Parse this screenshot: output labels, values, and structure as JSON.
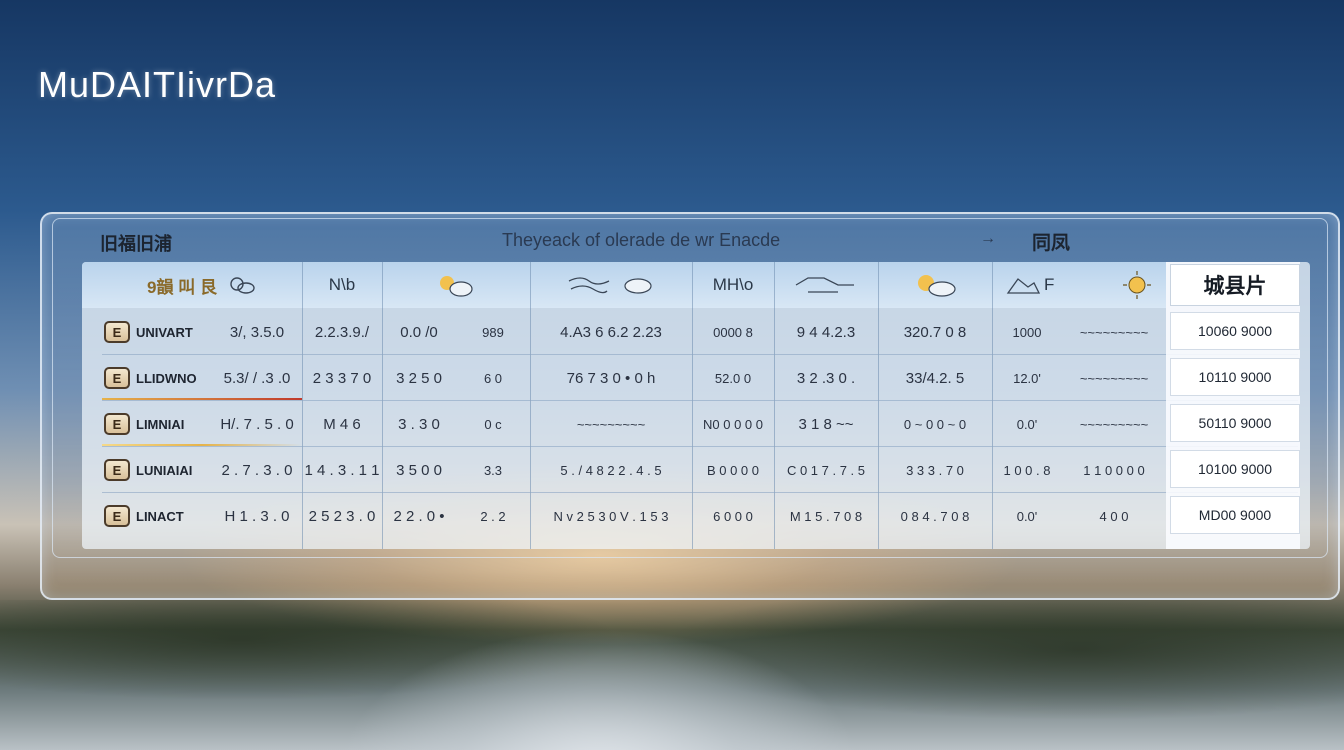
{
  "brand": "MuDAITIivrDa",
  "panel": {
    "header_left": "旧福旧浦",
    "header_mid": "Theyeack of olerade de wr Enacde",
    "header_arrow": "→",
    "header_right": "同凤"
  },
  "table": {
    "headers": [
      {
        "label": "9韻 叫 艮",
        "icon": "sun-cloud-icon"
      },
      {
        "label": "N\\b",
        "icon": "moon-icon"
      },
      {
        "label": "",
        "icon": "sun-cloud-icon"
      },
      {
        "label": "",
        "icon": "sun-cloud-icon"
      },
      {
        "label": "",
        "icon": "wind-icon"
      },
      {
        "label": "",
        "icon": "cloud-icon"
      },
      {
        "label": "MH\\o",
        "icon": ""
      },
      {
        "label": "",
        "icon": "wind-icon"
      },
      {
        "label": "",
        "icon": "sun-cloud-icon"
      },
      {
        "label": "F",
        "icon": "mountain-icon"
      },
      {
        "label": "",
        "icon": "sun-icon"
      }
    ],
    "right_header": "城县片",
    "rows": [
      {
        "month": "UNIVART",
        "badge": "E",
        "cells": [
          "3/, 3.5.0",
          "2.2.3.9./",
          "0.0 /0",
          "989",
          "4.A3 6 6.2 2.23",
          "0000 8",
          "9 4 4.2.3",
          "320.7 0 8",
          "1000",
          "~~~~~~~~~"
        ],
        "right": "10060 9000"
      },
      {
        "month": "LLIDWNO",
        "badge": "E",
        "cells": [
          "5.3/ / .3 .0",
          "2 3 3 7 0",
          "3 2 5 0",
          "6 0",
          "76 7 3 0 • 0 h",
          "52.0 0",
          "3 2 .3 0 .",
          "33/4.2. 5",
          "12.0'",
          "~~~~~~~~~"
        ],
        "right": "10110 9000"
      },
      {
        "month": "LIMNIAI",
        "badge": "E",
        "cells": [
          "H/. 7 . 5 . 0",
          "M 4 6",
          "3 . 3 0",
          "0 c",
          "~~~~~~~~~",
          "N0 0 0 0 0",
          "3 1 8 ~~",
          "0 ~ 0 0 ~ 0",
          "0.0'",
          "~~~~~~~~~"
        ],
        "right": "50110 9000"
      },
      {
        "month": "LUNIAIAI",
        "badge": "E",
        "cells": [
          "2 . 7 . 3 . 0",
          "1 4 . 3 . 1 1",
          "3 5 0 0",
          "3.3",
          "5 . / 4 8 2 2 . 4 . 5",
          "B 0 0 0 0",
          "C 0 1 7 . 7 . 5",
          "3 3 3 . 7 0",
          "1 0 0 . 8",
          "1 1 0 0 0 0"
        ],
        "right": "10100 9000"
      },
      {
        "month": "LINACT",
        "badge": "E",
        "cells": [
          "H 1 . 3 . 0",
          "2 5 2 3 . 0",
          "2 2 . 0 •",
          "2 . 2",
          "N v 2 5 3 0 V . 1 5 3",
          "6 0 0 0",
          "M 1 5 . 7 0 8",
          "0 8 4 . 7 0 8",
          "0.0'",
          "4 0 0"
        ],
        "right": "MD00 9000"
      }
    ]
  },
  "colors": {
    "sky_top": "#163763",
    "header_bg": "#b9d3ec",
    "row_accent_red": "#c0392b",
    "row_accent_gold": "#e6b34a",
    "icon_sun": "#f2c14e"
  }
}
